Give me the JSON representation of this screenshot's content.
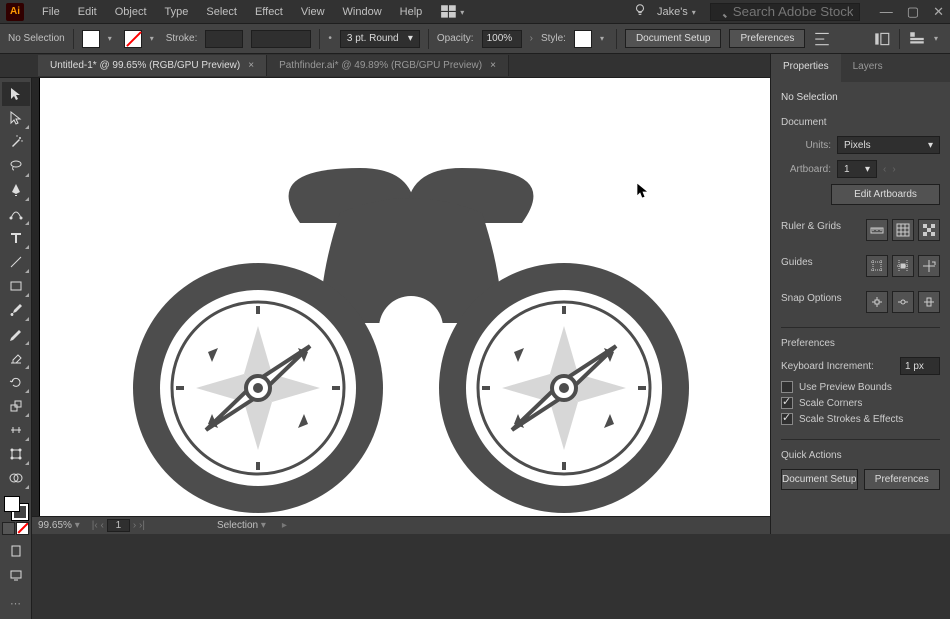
{
  "menubar": {
    "items": [
      "File",
      "Edit",
      "Object",
      "Type",
      "Select",
      "Effect",
      "View",
      "Window",
      "Help"
    ],
    "workspace": "Jake's",
    "search_placeholder": "Search Adobe Stock"
  },
  "optbar": {
    "selection_status": "No Selection",
    "stroke_label": "Stroke:",
    "stroke_weight": "",
    "stroke_profile": "3 pt. Round",
    "opacity_label": "Opacity:",
    "opacity": "100%",
    "style_label": "Style:",
    "doc_setup": "Document Setup",
    "prefs": "Preferences"
  },
  "tabs": [
    {
      "label": "Untitled-1* @ 99.65% (RGB/GPU Preview)",
      "active": true
    },
    {
      "label": "Pathfinder.ai* @ 49.89% (RGB/GPU Preview)",
      "active": false
    }
  ],
  "panel": {
    "tabs": {
      "properties": "Properties",
      "layers": "Layers"
    },
    "nosel": "No Selection",
    "doc_title": "Document",
    "units_label": "Units:",
    "units": "Pixels",
    "artboard_label": "Artboard:",
    "artboard": "1",
    "edit_artboards": "Edit Artboards",
    "ruler_grids": "Ruler & Grids",
    "guides": "Guides",
    "snap": "Snap Options",
    "prefs_title": "Preferences",
    "kbd_inc_label": "Keyboard Increment:",
    "kbd_inc": "1 px",
    "chk_preview": "Use Preview Bounds",
    "chk_corners": "Scale Corners",
    "chk_strokes": "Scale Strokes & Effects",
    "quick": "Quick Actions",
    "qa_doc": "Document Setup",
    "qa_pref": "Preferences"
  },
  "status": {
    "zoom": "99.65%",
    "artboard_nav": "1",
    "tool": "Selection"
  }
}
